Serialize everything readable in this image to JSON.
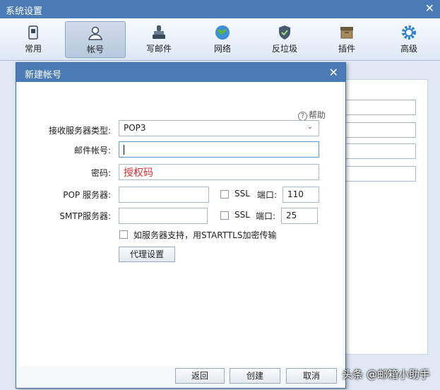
{
  "window": {
    "title": "系统设置",
    "close": "✕"
  },
  "toolbar": {
    "items": [
      {
        "label": "常用",
        "icon": "phone-icon"
      },
      {
        "label": "帐号",
        "icon": "user-icon"
      },
      {
        "label": "写邮件",
        "icon": "stamp-icon"
      },
      {
        "label": "网络",
        "icon": "globe-icon"
      },
      {
        "label": "反垃圾",
        "icon": "shield-icon"
      },
      {
        "label": "插件",
        "icon": "box-icon"
      },
      {
        "label": "高级",
        "icon": "gear-icon"
      }
    ],
    "active_index": 1
  },
  "dialog": {
    "title": "新建帐号",
    "close": "✕",
    "help": "帮助",
    "fields": {
      "server_type": {
        "label": "接收服务器类型:",
        "value": "POP3"
      },
      "account": {
        "label": "邮件帐号:",
        "value": ""
      },
      "password": {
        "label": "密码:",
        "value": "授权码"
      },
      "pop": {
        "label": "POP 服务器:",
        "value": "",
        "ssl": "SSL",
        "port_label": "端口:",
        "port": "110"
      },
      "smtp": {
        "label": "SMTP服务器:",
        "value": "",
        "ssl": "SSL",
        "port_label": "端口:",
        "port": "25"
      }
    },
    "starttls": "如服务器支持，用STARTTLS加密传输",
    "proxy_button": "代理设置",
    "buttons": {
      "back": "返回",
      "create": "创建",
      "cancel": "取消"
    }
  },
  "watermark": "头条 @邮箱小助手"
}
